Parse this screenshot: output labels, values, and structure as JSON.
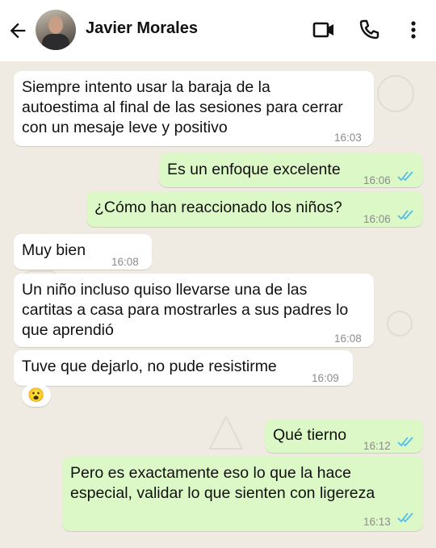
{
  "header": {
    "contact_name": "Javier Morales"
  },
  "messages": [
    {
      "lines": [
        "Siempre intento usar la baraja de la",
        "autoestima al final de las sesiones para cerrar",
        "con un mesaje leve y positivo"
      ],
      "time": "16:03",
      "direction": "incoming"
    },
    {
      "lines": [
        "Es un enfoque excelente"
      ],
      "time": "16:06",
      "direction": "outgoing",
      "status": "read"
    },
    {
      "lines": [
        "¿Cómo han reaccionado los niños?"
      ],
      "time": "16:06",
      "direction": "outgoing",
      "status": "read"
    },
    {
      "lines": [
        "Muy bien"
      ],
      "time": "16:08",
      "direction": "incoming"
    },
    {
      "lines": [
        "Un niño incluso quiso llevarse una de las",
        "cartitas a casa para mostrarles a sus padres lo",
        "que aprendió"
      ],
      "time": "16:08",
      "direction": "incoming"
    },
    {
      "lines": [
        "Tuve que dejarlo, no pude resistirme"
      ],
      "time": "16:09",
      "direction": "incoming",
      "reaction": "😮"
    },
    {
      "lines": [
        "Qué tierno"
      ],
      "time": "16:12",
      "direction": "outgoing",
      "status": "read"
    },
    {
      "lines": [
        "Pero es exactamente eso lo que la hace",
        "especial, validar lo que sienten con ligereza"
      ],
      "time": "16:13",
      "direction": "outgoing",
      "status": "read"
    }
  ],
  "colors": {
    "incoming_bubble": "#ffffff",
    "outgoing_bubble": "#dcf8c6",
    "chat_background": "#efeae2",
    "read_ticks": "#53bdeb"
  },
  "icons": [
    "back-arrow-icon",
    "video-call-icon",
    "phone-icon",
    "more-options-icon",
    "read-receipt-icon"
  ]
}
